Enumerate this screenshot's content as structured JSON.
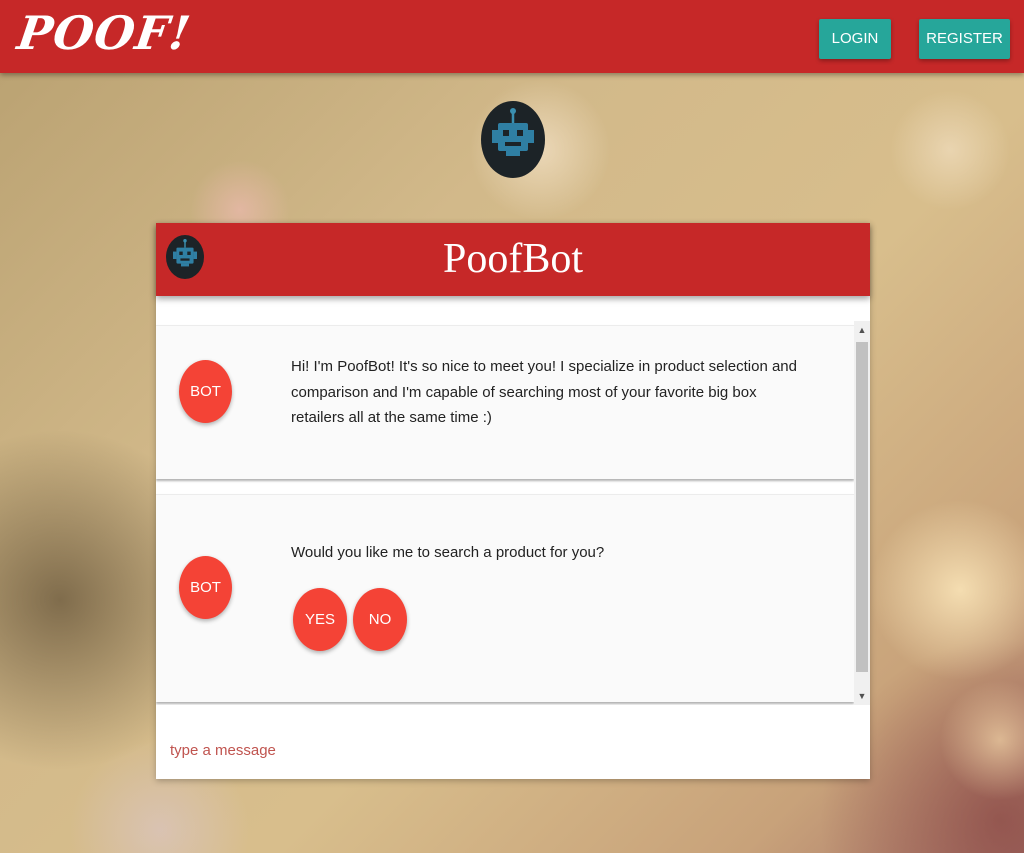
{
  "navbar": {
    "logo": "POOF!",
    "login_label": "LOGIN",
    "register_label": "REGISTER"
  },
  "chat": {
    "title": "PoofBot",
    "messages": [
      {
        "sender": "BOT",
        "text": "Hi! I'm PoofBot! It's so nice to meet you! I specialize in product selection and comparison and I'm capable of searching most of your favorite big box retailers all at the same time :)"
      },
      {
        "sender": "BOT",
        "text": "Would you like me to search a product for you?",
        "choices": [
          "YES",
          "NO"
        ]
      }
    ],
    "input_placeholder": "type a message"
  },
  "icons": [
    "robot-icon",
    "scroll-up-arrow-icon",
    "scroll-down-arrow-icon"
  ],
  "colors": {
    "header_red": "#c62828",
    "bot_badge_red": "#f44336",
    "teal_button": "#26a69a"
  }
}
